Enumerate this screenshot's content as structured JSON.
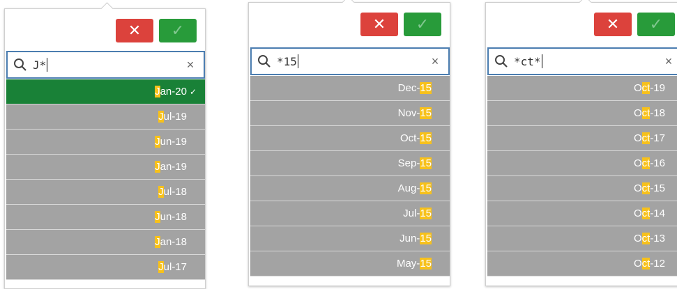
{
  "buttons": {
    "cancel_icon": "✕",
    "confirm_icon": "✓"
  },
  "colors": {
    "cancel": "#dc423c",
    "confirm": "#289b3a",
    "selected": "#198137",
    "highlight": "#f7c11b",
    "row": "#a3a3a3",
    "search_border": "#4b7db0"
  },
  "panels": [
    {
      "search_value": "J*",
      "clear_icon": "×",
      "items": [
        {
          "pre": "",
          "hl": "J",
          "post": "an-20",
          "selected": true,
          "check": "✓"
        },
        {
          "pre": "",
          "hl": "J",
          "post": "ul-19"
        },
        {
          "pre": "",
          "hl": "J",
          "post": "un-19"
        },
        {
          "pre": "",
          "hl": "J",
          "post": "an-19"
        },
        {
          "pre": "",
          "hl": "J",
          "post": "ul-18"
        },
        {
          "pre": "",
          "hl": "J",
          "post": "un-18"
        },
        {
          "pre": "",
          "hl": "J",
          "post": "an-18"
        },
        {
          "pre": "",
          "hl": "J",
          "post": "ul-17"
        }
      ]
    },
    {
      "search_value": "*15",
      "clear_icon": "×",
      "items": [
        {
          "pre": "Dec-",
          "hl": "15",
          "post": ""
        },
        {
          "pre": "Nov-",
          "hl": "15",
          "post": ""
        },
        {
          "pre": "Oct-",
          "hl": "15",
          "post": ""
        },
        {
          "pre": "Sep-",
          "hl": "15",
          "post": ""
        },
        {
          "pre": "Aug-",
          "hl": "15",
          "post": ""
        },
        {
          "pre": "Jul-",
          "hl": "15",
          "post": ""
        },
        {
          "pre": "Jun-",
          "hl": "15",
          "post": ""
        },
        {
          "pre": "May-",
          "hl": "15",
          "post": ""
        }
      ]
    },
    {
      "search_value": "*ct*",
      "clear_icon": "×",
      "items": [
        {
          "pre": "O",
          "hl": "ct",
          "post": "-19"
        },
        {
          "pre": "O",
          "hl": "ct",
          "post": "-18"
        },
        {
          "pre": "O",
          "hl": "ct",
          "post": "-17"
        },
        {
          "pre": "O",
          "hl": "ct",
          "post": "-16"
        },
        {
          "pre": "O",
          "hl": "ct",
          "post": "-15"
        },
        {
          "pre": "O",
          "hl": "ct",
          "post": "-14"
        },
        {
          "pre": "O",
          "hl": "ct",
          "post": "-13"
        },
        {
          "pre": "O",
          "hl": "ct",
          "post": "-12"
        }
      ]
    }
  ]
}
